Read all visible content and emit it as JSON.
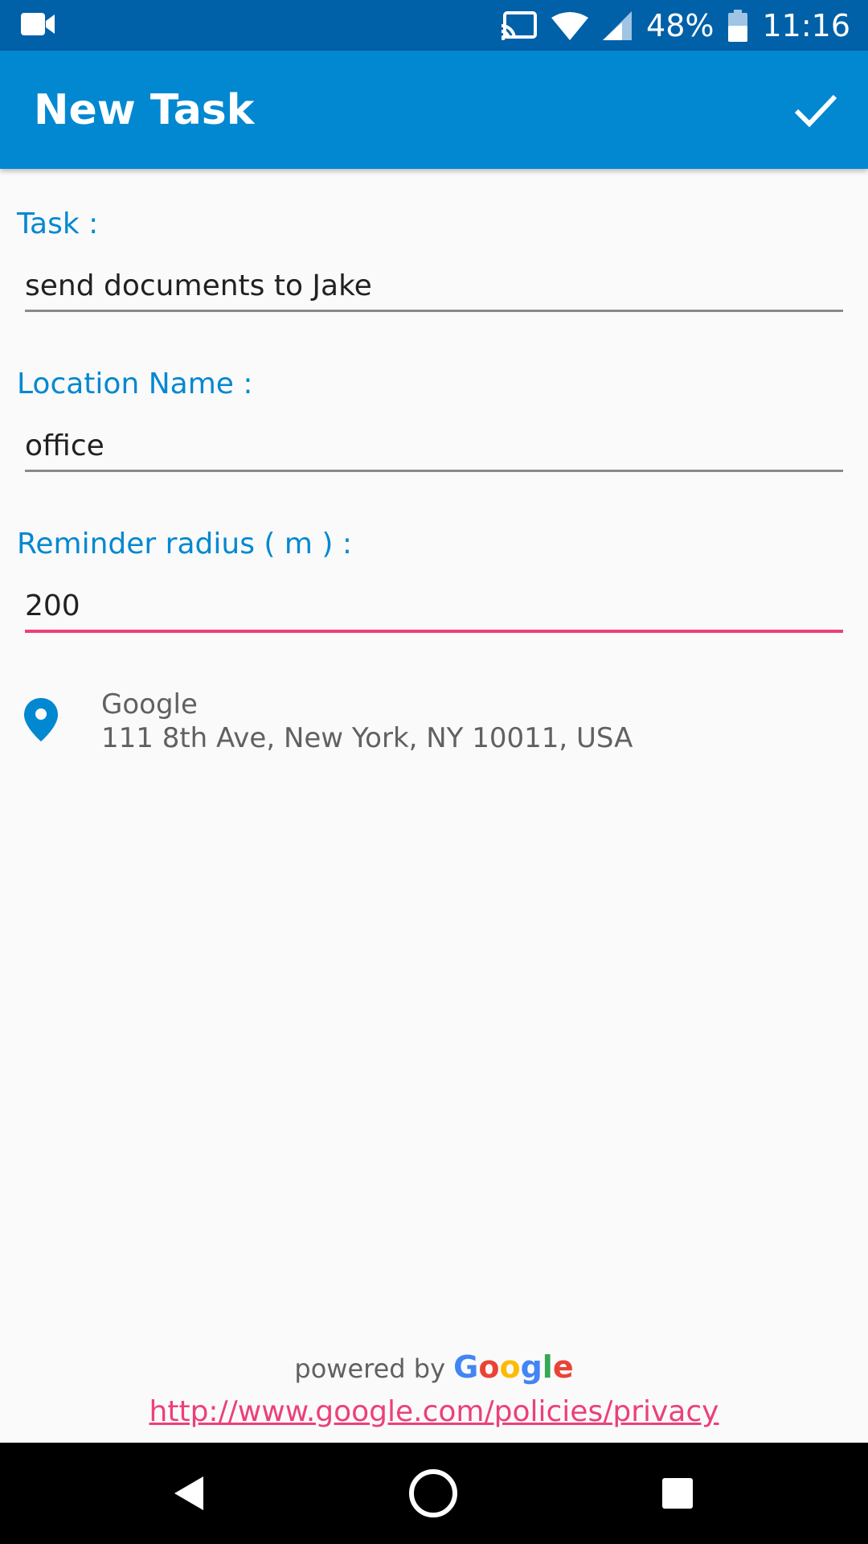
{
  "status_bar": {
    "battery": "48%",
    "time": "11:16",
    "icons": [
      "video-call-icon",
      "cast-icon",
      "wifi-icon",
      "signal-icon",
      "battery-icon"
    ]
  },
  "app_bar": {
    "title": "New Task",
    "action_icon": "check-icon"
  },
  "form": {
    "task": {
      "label": "Task :",
      "value": "send documents to Jake"
    },
    "location_name": {
      "label": "Location Name :",
      "value": "office"
    },
    "reminder_radius": {
      "label": "Reminder radius ( m ) :",
      "value": "200"
    }
  },
  "place": {
    "icon": "location-pin-icon",
    "name": "Google",
    "address": "111 8th Ave, New York, NY 10011, USA"
  },
  "attribution": {
    "powered_by": "powered by",
    "google_letters": [
      "G",
      "o",
      "o",
      "g",
      "l",
      "e"
    ],
    "google_colors": [
      "#4285F4",
      "#EA4335",
      "#FBBC05",
      "#4285F4",
      "#34A853",
      "#EA4335"
    ],
    "privacy_link": "http://www.google.com/policies/privacy"
  },
  "colors": {
    "status_bar": "#0060a8",
    "app_bar": "#0288d1",
    "label": "#0288d1",
    "accent": "#ec407a"
  },
  "nav_bar": [
    "back-icon",
    "home-icon",
    "recents-icon"
  ]
}
